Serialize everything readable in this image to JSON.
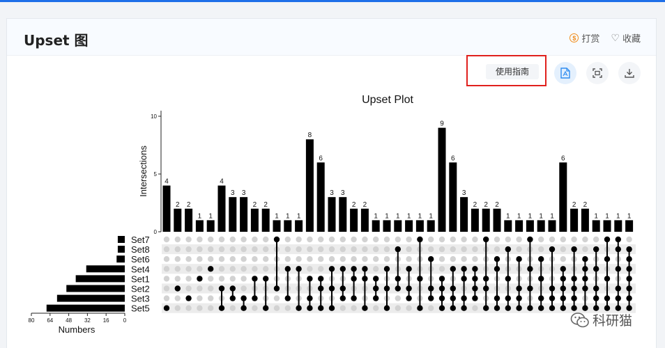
{
  "page": {
    "title": "Upset 图"
  },
  "header": {
    "tip_label": "打赏",
    "tip_icon": "¥-coin-icon",
    "favorite_label": "收藏",
    "favorite_icon": "heart-icon"
  },
  "toolbar": {
    "guide_label": "使用指南",
    "buttons": [
      "pdf-file-icon",
      "fullscreen-icon",
      "download-icon"
    ]
  },
  "watermark": {
    "text": "科研猫"
  },
  "chart_data": {
    "type": "upset",
    "title": "Upset Plot",
    "ylabel": "Intersections",
    "xlabel": "Numbers",
    "ylim": [
      0,
      10
    ],
    "y_ticks": [
      0,
      5,
      10
    ],
    "x_ticks": [
      80,
      64,
      48,
      32,
      16,
      0
    ],
    "set_size_max": 80,
    "sets": [
      {
        "name": "Set7",
        "size": 6
      },
      {
        "name": "Set8",
        "size": 6
      },
      {
        "name": "Set6",
        "size": 7
      },
      {
        "name": "Set4",
        "size": 33
      },
      {
        "name": "Set1",
        "size": 42
      },
      {
        "name": "Set2",
        "size": 50
      },
      {
        "name": "Set3",
        "size": 58
      },
      {
        "name": "Set5",
        "size": 67
      }
    ],
    "intersections": [
      {
        "count": 4,
        "sets": [
          "Set5"
        ]
      },
      {
        "count": 2,
        "sets": [
          "Set2"
        ]
      },
      {
        "count": 2,
        "sets": [
          "Set3"
        ]
      },
      {
        "count": 1,
        "sets": [
          "Set1"
        ]
      },
      {
        "count": 1,
        "sets": [
          "Set4"
        ]
      },
      {
        "count": 4,
        "sets": [
          "Set2",
          "Set5"
        ]
      },
      {
        "count": 3,
        "sets": [
          "Set2",
          "Set3"
        ]
      },
      {
        "count": 3,
        "sets": [
          "Set3",
          "Set5"
        ]
      },
      {
        "count": 2,
        "sets": [
          "Set1",
          "Set3"
        ]
      },
      {
        "count": 2,
        "sets": [
          "Set1",
          "Set5"
        ]
      },
      {
        "count": 1,
        "sets": [
          "Set7",
          "Set2"
        ]
      },
      {
        "count": 1,
        "sets": [
          "Set4",
          "Set3"
        ]
      },
      {
        "count": 1,
        "sets": [
          "Set4",
          "Set5"
        ]
      },
      {
        "count": 8,
        "sets": [
          "Set1",
          "Set3",
          "Set5"
        ]
      },
      {
        "count": 6,
        "sets": [
          "Set1",
          "Set2",
          "Set5"
        ]
      },
      {
        "count": 3,
        "sets": [
          "Set4",
          "Set2",
          "Set5"
        ]
      },
      {
        "count": 3,
        "sets": [
          "Set4",
          "Set2",
          "Set3"
        ]
      },
      {
        "count": 2,
        "sets": [
          "Set4",
          "Set1",
          "Set3"
        ]
      },
      {
        "count": 2,
        "sets": [
          "Set4",
          "Set1",
          "Set5"
        ]
      },
      {
        "count": 1,
        "sets": [
          "Set1",
          "Set2",
          "Set3"
        ]
      },
      {
        "count": 1,
        "sets": [
          "Set4",
          "Set2",
          "Set5"
        ]
      },
      {
        "count": 1,
        "sets": [
          "Set8",
          "Set1",
          "Set2"
        ]
      },
      {
        "count": 1,
        "sets": [
          "Set4",
          "Set2",
          "Set3"
        ]
      },
      {
        "count": 1,
        "sets": [
          "Set7",
          "Set1",
          "Set5"
        ]
      },
      {
        "count": 1,
        "sets": [
          "Set6",
          "Set2",
          "Set3"
        ]
      },
      {
        "count": 9,
        "sets": [
          "Set1",
          "Set2",
          "Set3",
          "Set5"
        ]
      },
      {
        "count": 6,
        "sets": [
          "Set4",
          "Set2",
          "Set3",
          "Set5"
        ]
      },
      {
        "count": 3,
        "sets": [
          "Set4",
          "Set1",
          "Set3",
          "Set5"
        ]
      },
      {
        "count": 2,
        "sets": [
          "Set4",
          "Set1",
          "Set2",
          "Set3"
        ]
      },
      {
        "count": 2,
        "sets": [
          "Set7",
          "Set1",
          "Set2",
          "Set5"
        ]
      },
      {
        "count": 2,
        "sets": [
          "Set6",
          "Set4",
          "Set3",
          "Set5"
        ]
      },
      {
        "count": 1,
        "sets": [
          "Set8",
          "Set1",
          "Set3",
          "Set5"
        ]
      },
      {
        "count": 1,
        "sets": [
          "Set6",
          "Set2",
          "Set3",
          "Set5"
        ]
      },
      {
        "count": 1,
        "sets": [
          "Set7",
          "Set4",
          "Set2",
          "Set5"
        ]
      },
      {
        "count": 1,
        "sets": [
          "Set6",
          "Set1",
          "Set3",
          "Set5"
        ]
      },
      {
        "count": 1,
        "sets": [
          "Set8",
          "Set2",
          "Set3",
          "Set5"
        ]
      },
      {
        "count": 6,
        "sets": [
          "Set4",
          "Set1",
          "Set2",
          "Set3",
          "Set5"
        ]
      },
      {
        "count": 2,
        "sets": [
          "Set8",
          "Set1",
          "Set2",
          "Set3",
          "Set5"
        ]
      },
      {
        "count": 2,
        "sets": [
          "Set6",
          "Set4",
          "Set1",
          "Set2",
          "Set5"
        ]
      },
      {
        "count": 1,
        "sets": [
          "Set8",
          "Set4",
          "Set2",
          "Set3",
          "Set5"
        ]
      },
      {
        "count": 1,
        "sets": [
          "Set7",
          "Set6",
          "Set1",
          "Set3",
          "Set5"
        ]
      },
      {
        "count": 1,
        "sets": [
          "Set7",
          "Set8",
          "Set4",
          "Set2",
          "Set3",
          "Set5"
        ]
      },
      {
        "count": 1,
        "sets": [
          "Set8",
          "Set6",
          "Set4",
          "Set1",
          "Set2",
          "Set3",
          "Set5"
        ]
      }
    ]
  }
}
